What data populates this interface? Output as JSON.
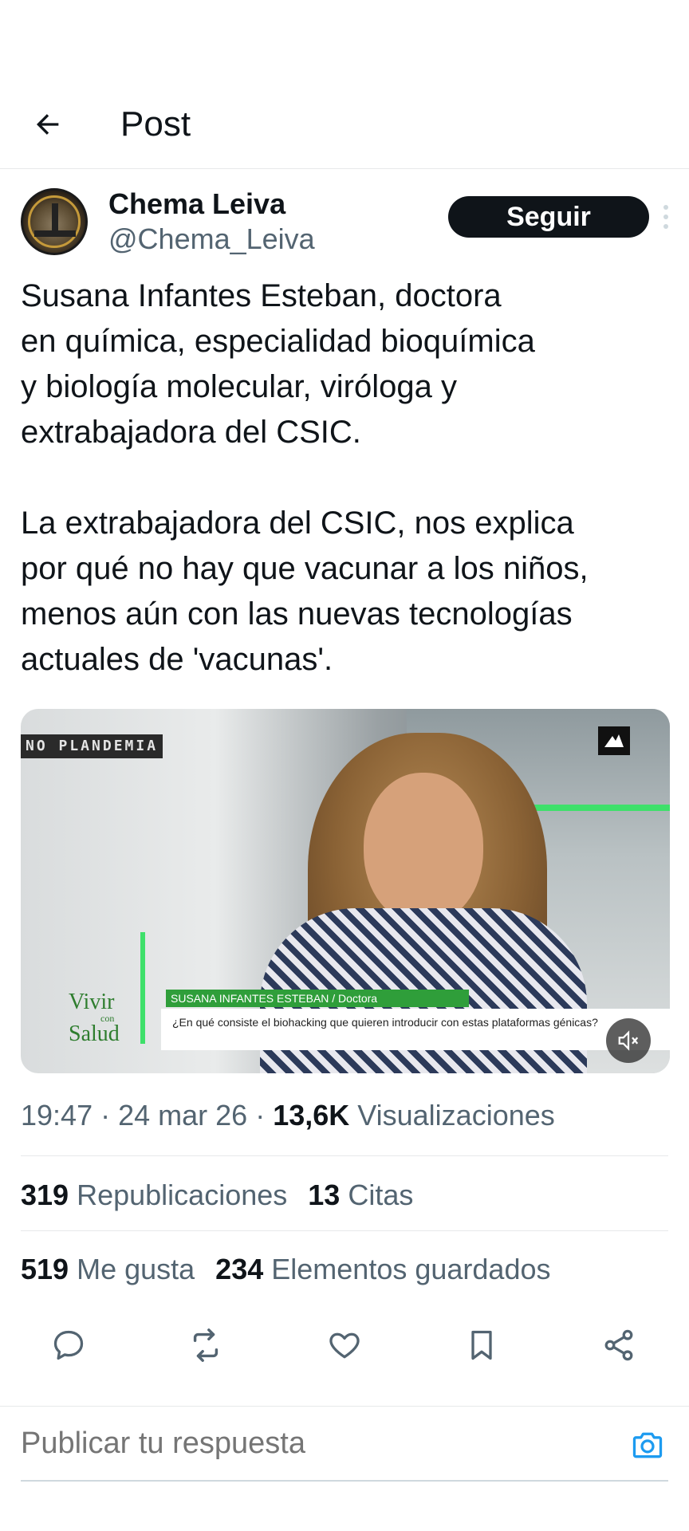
{
  "header": {
    "back_icon": "arrow-left-icon",
    "title": "Post"
  },
  "author": {
    "name": "Chema Leiva",
    "handle": "@Chema_Leiva",
    "follow_label": "Seguir"
  },
  "tweet": {
    "text": "Susana Infantes Esteban, doctora\nen química, especialidad bioquímica\ny biología molecular, viróloga y\nextrabajadora del CSIC.\n\nLa extrabajadora del CSIC, nos explica\npor qué no hay que vacunar a los niños,\nmenos aún con las nuevas tecnologías\nactuales de 'vacunas'."
  },
  "media": {
    "watermark": "NO PLANDEMIA",
    "show_logo_top": "Vivir",
    "show_logo_mid": "con",
    "show_logo_bottom": "Salud",
    "lower_third_name": "SUSANA INFANTES ESTEBAN / Doctora",
    "lower_third_question": "¿En qué consiste el biohacking que quieren introducir con estas plataformas génicas?",
    "mute_icon": "muted-speaker-icon"
  },
  "meta": {
    "time": "19:47",
    "sep1": " · ",
    "date": "24 mar 26",
    "sep2": " · ",
    "views_count": "13,6K",
    "views_label": "Visualizaciones"
  },
  "stats": {
    "reposts_count": "319",
    "reposts_label": "Republicaciones",
    "quotes_count": "13",
    "quotes_label": "Citas",
    "likes_count": "519",
    "likes_label": "Me gusta",
    "bookmarks_count": "234",
    "bookmarks_label": "Elementos guardados"
  },
  "actions": {
    "reply_icon": "reply-icon",
    "repost_icon": "repost-icon",
    "like_icon": "heart-icon",
    "bookmark_icon": "bookmark-icon",
    "share_icon": "share-icon"
  },
  "reply": {
    "placeholder": "Publicar tu respuesta",
    "camera_icon": "camera-icon"
  },
  "colors": {
    "text_primary": "#0f1419",
    "text_secondary": "#536471",
    "accent_blue": "#1d9bf0",
    "follow_bg": "#0f1419",
    "divider": "#e7e9ea"
  }
}
